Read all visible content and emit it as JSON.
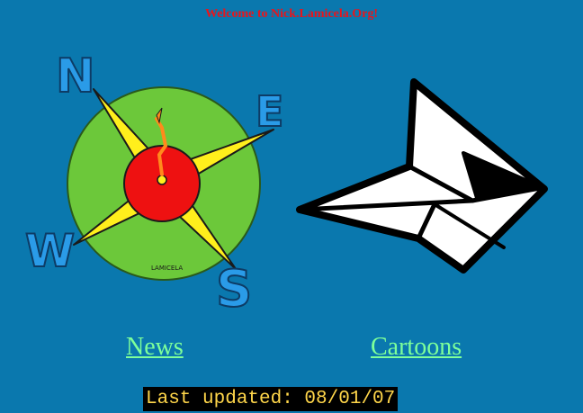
{
  "header": {
    "welcome": "Welcome to Nick.Lamicela.Org!"
  },
  "compass": {
    "letters": {
      "north": "N",
      "east": "E",
      "south": "S",
      "west": "W"
    },
    "signature": "LAMICELA"
  },
  "nav": {
    "news_label": "News",
    "cartoons_label": "Cartoons"
  },
  "footer": {
    "last_updated": "Last updated: 08/01/07"
  },
  "colors": {
    "background": "#0a78ae",
    "welcome_text": "#e8151c",
    "link": "#7dff9a",
    "updated_text": "#ffd64a",
    "updated_bg": "#000000"
  }
}
